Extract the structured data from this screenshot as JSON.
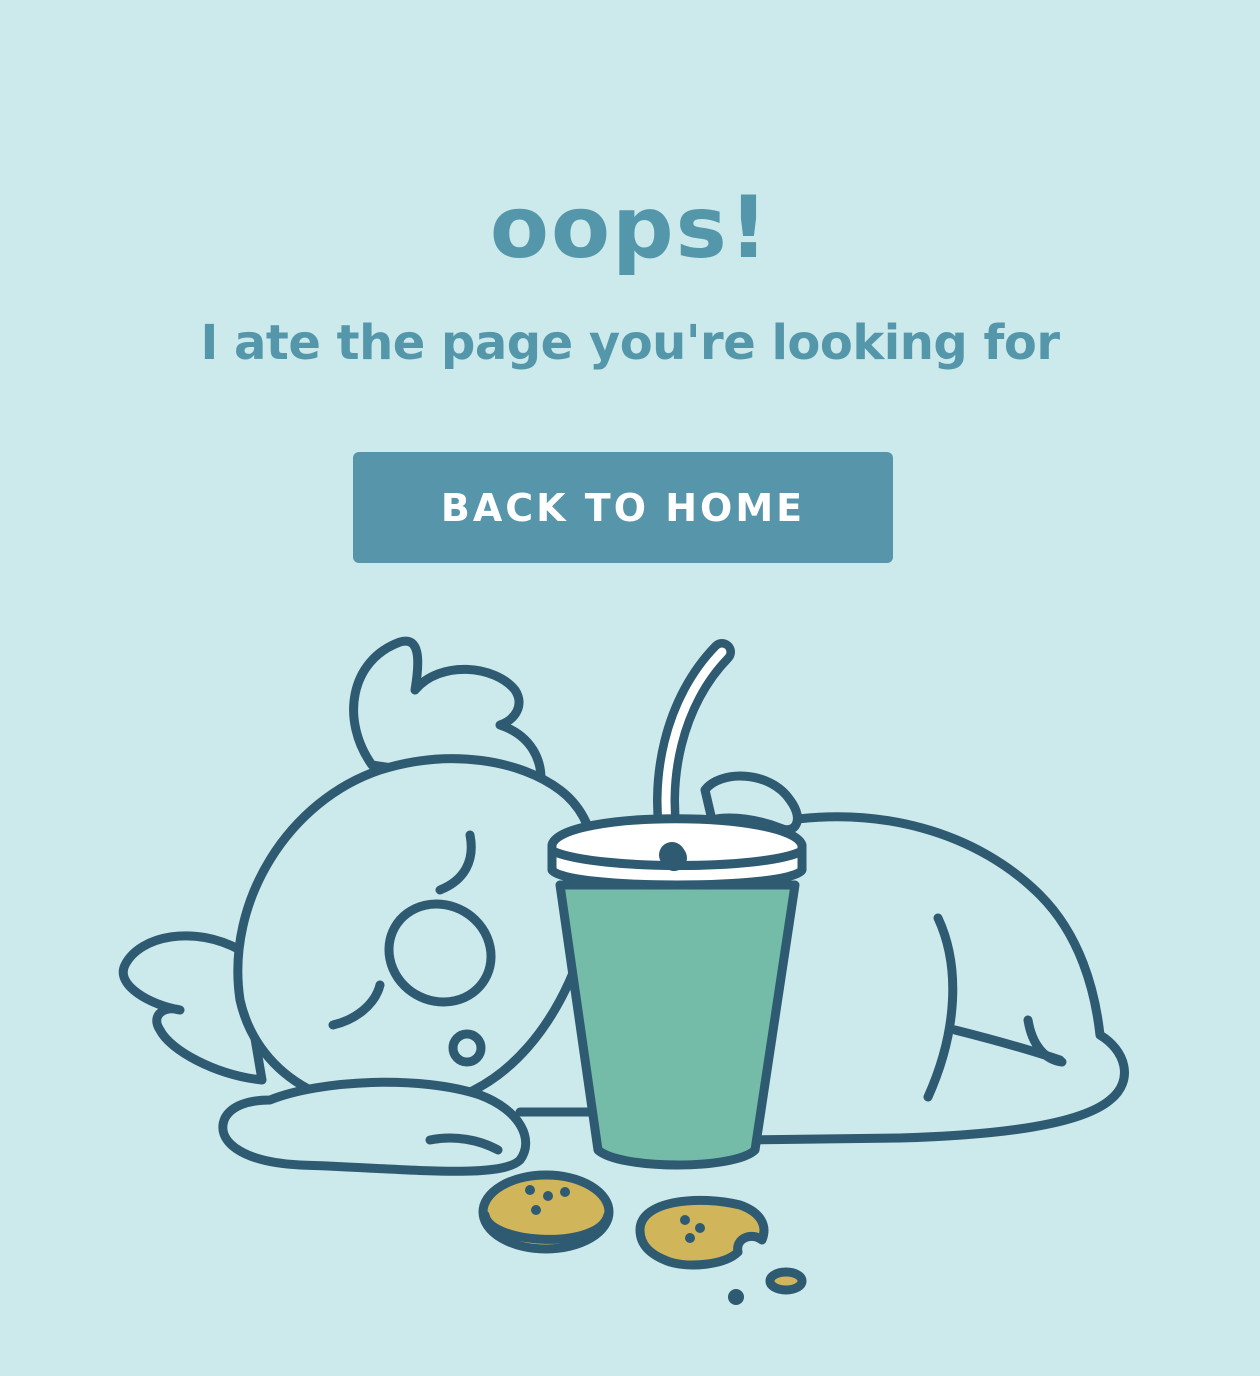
{
  "error": {
    "title": "oops!",
    "message": "I ate the page you're looking for",
    "button_label": "BACK TO HOME"
  },
  "illustration": {
    "subject": "sleeping-koala-icon",
    "objects": [
      "drink-cup-icon",
      "cookie-icon",
      "bitten-cookie-icon"
    ]
  },
  "colors": {
    "background": "#cce9ec",
    "accent": "#5497aa",
    "button": "#5795aa",
    "outline": "#2e5a72",
    "cup": "#74bca8",
    "cookie": "#d1b55a"
  }
}
